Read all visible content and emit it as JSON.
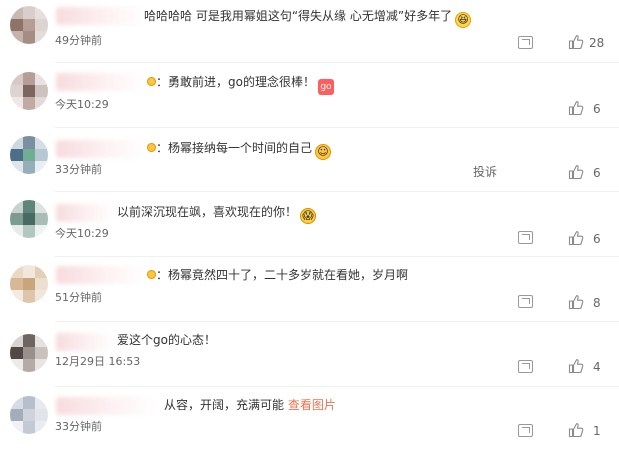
{
  "comments": [
    {
      "text": "哈哈哈哈 可是我用幂姐这句“得失从缘 心无增减”好多年了",
      "emoji": "laughing-emoji",
      "time": "49分钟前",
      "likes": "28"
    },
    {
      "text": "：勇敢前进，go的理念很棒！",
      "emoji": "go-sticker-emoji",
      "time": "今天10:29",
      "likes": "6"
    },
    {
      "text": "：杨幂接纳每一个时间的自己",
      "emoji": "blush-emoji",
      "time": "33分钟前",
      "likes": "6",
      "report": "投诉"
    },
    {
      "text": "以前深沉现在飒，喜欢现在的你！",
      "emoji": "shocked-emoji",
      "time": "今天10:29",
      "likes": "6"
    },
    {
      "text": "：杨幂竟然四十了，二十多岁就在看她，岁月啊",
      "time": "51分钟前",
      "likes": "8"
    },
    {
      "text": "爱这个go的心态！",
      "time": "12月29日 16:53",
      "likes": "4"
    },
    {
      "text": "从容，开阔，充满可能",
      "link": "查看图片",
      "time": "33分钟前",
      "likes": "1"
    }
  ],
  "colors": {
    "text": "#333333",
    "meta": "#666666",
    "link": "#eb7350",
    "icon": "#999999"
  }
}
